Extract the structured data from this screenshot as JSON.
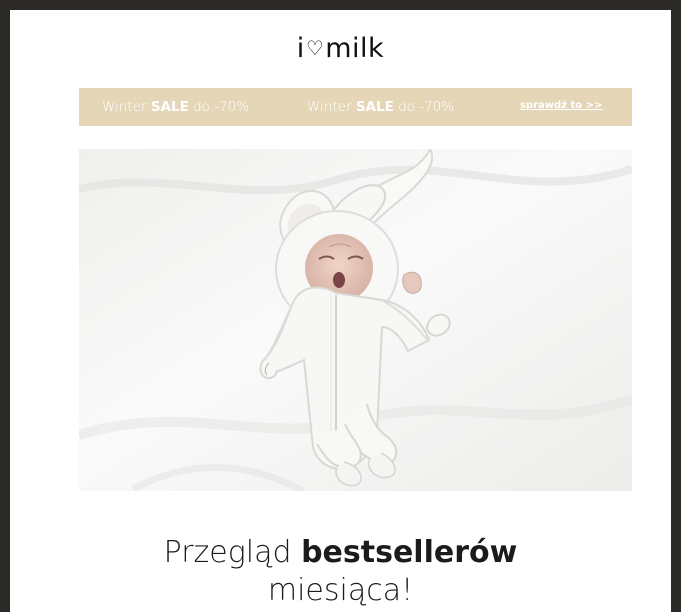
{
  "brand": {
    "before": "i",
    "heart": "♡",
    "after": "milk"
  },
  "banner": {
    "sale_prefix_1": "Winter ",
    "sale_bold_1": "SALE",
    "sale_suffix_1": " do -70%",
    "sale_prefix_2": "Winter ",
    "sale_bold_2": "SALE",
    "sale_suffix_2": " do -70%",
    "cta": "sprawdź to >>"
  },
  "headline": {
    "line1_regular": "Przegląd ",
    "line1_bold": "bestsellerów",
    "line2": "miesiąca!"
  },
  "colors": {
    "outer_background": "#2b2a27",
    "banner": "#e6d6b8",
    "text": "#1b1b1b",
    "white": "#ffffff"
  },
  "images": {
    "hero": "baby in white bunny-ear onesie"
  }
}
